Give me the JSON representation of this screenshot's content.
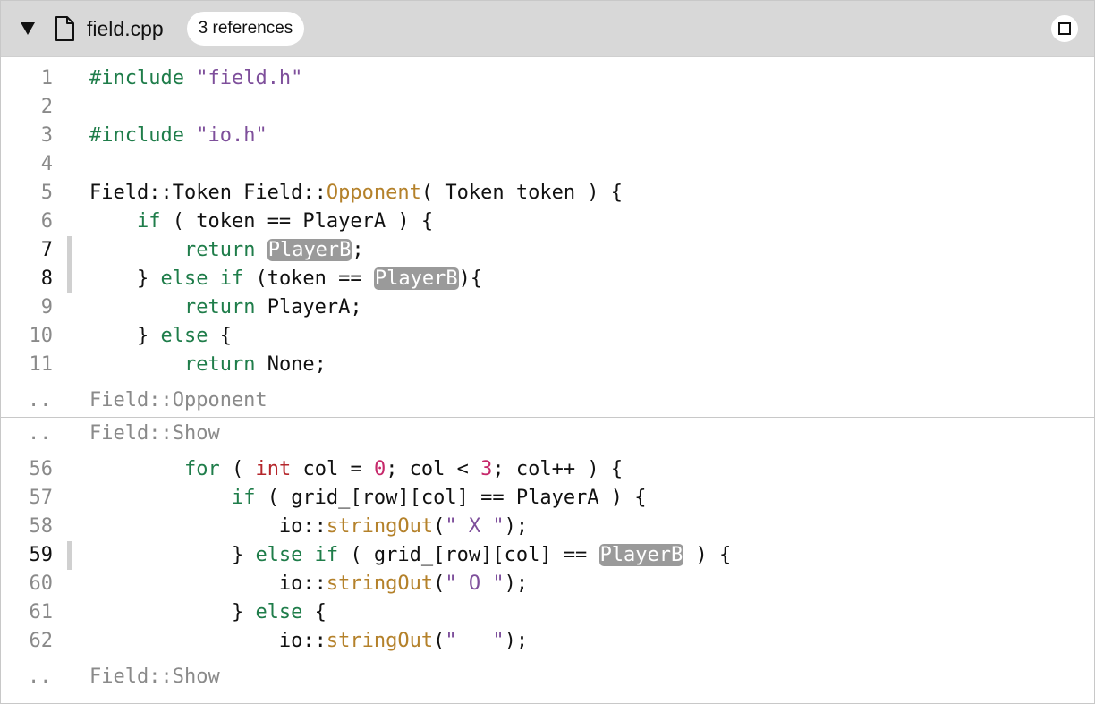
{
  "header": {
    "file_name": "field.cpp",
    "references_badge": "3 references"
  },
  "sections": [
    {
      "lines": [
        {
          "num": "1",
          "active": false,
          "marker": false,
          "tokens": [
            {
              "t": "kw",
              "v": "#include"
            },
            {
              "t": "",
              "v": " "
            },
            {
              "t": "str",
              "v": "\"field.h\""
            }
          ]
        },
        {
          "num": "2",
          "active": false,
          "marker": false,
          "tokens": []
        },
        {
          "num": "3",
          "active": false,
          "marker": false,
          "tokens": [
            {
              "t": "kw",
              "v": "#include"
            },
            {
              "t": "",
              "v": " "
            },
            {
              "t": "str",
              "v": "\"io.h\""
            }
          ]
        },
        {
          "num": "4",
          "active": false,
          "marker": false,
          "tokens": []
        },
        {
          "num": "5",
          "active": false,
          "marker": false,
          "tokens": [
            {
              "t": "",
              "v": "Field::Token Field::"
            },
            {
              "t": "fn",
              "v": "Opponent"
            },
            {
              "t": "",
              "v": "( Token token ) {"
            }
          ]
        },
        {
          "num": "6",
          "active": false,
          "marker": false,
          "tokens": [
            {
              "t": "",
              "v": "    "
            },
            {
              "t": "kw",
              "v": "if"
            },
            {
              "t": "",
              "v": " ( token == PlayerA ) {"
            }
          ]
        },
        {
          "num": "7",
          "active": true,
          "marker": true,
          "tokens": [
            {
              "t": "",
              "v": "        "
            },
            {
              "t": "kw",
              "v": "return"
            },
            {
              "t": "",
              "v": " "
            },
            {
              "t": "hl",
              "v": "PlayerB"
            },
            {
              "t": "",
              "v": ";"
            }
          ]
        },
        {
          "num": "8",
          "active": true,
          "marker": true,
          "tokens": [
            {
              "t": "",
              "v": "    } "
            },
            {
              "t": "kw",
              "v": "else if"
            },
            {
              "t": "",
              "v": " (token == "
            },
            {
              "t": "hl",
              "v": "PlayerB"
            },
            {
              "t": "",
              "v": "){"
            }
          ]
        },
        {
          "num": "9",
          "active": false,
          "marker": false,
          "tokens": [
            {
              "t": "",
              "v": "        "
            },
            {
              "t": "kw",
              "v": "return"
            },
            {
              "t": "",
              "v": " PlayerA;"
            }
          ]
        },
        {
          "num": "10",
          "active": false,
          "marker": false,
          "tokens": [
            {
              "t": "",
              "v": "    } "
            },
            {
              "t": "kw",
              "v": "else"
            },
            {
              "t": "",
              "v": " {"
            }
          ]
        },
        {
          "num": "11",
          "active": false,
          "marker": false,
          "tokens": [
            {
              "t": "",
              "v": "        "
            },
            {
              "t": "kw",
              "v": "return"
            },
            {
              "t": "",
              "v": " None;"
            }
          ]
        }
      ],
      "fold_after": {
        "dots": "..",
        "label": "Field::Opponent"
      }
    },
    {
      "fold_before": {
        "dots": "..",
        "label": "Field::Show"
      },
      "lines": [
        {
          "num": "56",
          "active": false,
          "marker": false,
          "tokens": [
            {
              "t": "",
              "v": "        "
            },
            {
              "t": "kw",
              "v": "for"
            },
            {
              "t": "",
              "v": " ( "
            },
            {
              "t": "ty",
              "v": "int"
            },
            {
              "t": "",
              "v": " col = "
            },
            {
              "t": "num",
              "v": "0"
            },
            {
              "t": "",
              "v": "; col < "
            },
            {
              "t": "num",
              "v": "3"
            },
            {
              "t": "",
              "v": "; col++ ) {"
            }
          ]
        },
        {
          "num": "57",
          "active": false,
          "marker": false,
          "tokens": [
            {
              "t": "",
              "v": "            "
            },
            {
              "t": "kw",
              "v": "if"
            },
            {
              "t": "",
              "v": " ( grid_[row][col] == PlayerA ) {"
            }
          ]
        },
        {
          "num": "58",
          "active": false,
          "marker": false,
          "tokens": [
            {
              "t": "",
              "v": "                io::"
            },
            {
              "t": "fn",
              "v": "stringOut"
            },
            {
              "t": "",
              "v": "("
            },
            {
              "t": "str",
              "v": "\" X \""
            },
            {
              "t": "",
              "v": ");"
            }
          ]
        },
        {
          "num": "59",
          "active": true,
          "marker": true,
          "tokens": [
            {
              "t": "",
              "v": "            } "
            },
            {
              "t": "kw",
              "v": "else if"
            },
            {
              "t": "",
              "v": " ( grid_[row][col] == "
            },
            {
              "t": "hl",
              "v": "PlayerB"
            },
            {
              "t": "",
              "v": " ) {"
            }
          ]
        },
        {
          "num": "60",
          "active": false,
          "marker": false,
          "tokens": [
            {
              "t": "",
              "v": "                io::"
            },
            {
              "t": "fn",
              "v": "stringOut"
            },
            {
              "t": "",
              "v": "("
            },
            {
              "t": "str",
              "v": "\" O \""
            },
            {
              "t": "",
              "v": ");"
            }
          ]
        },
        {
          "num": "61",
          "active": false,
          "marker": false,
          "tokens": [
            {
              "t": "",
              "v": "            } "
            },
            {
              "t": "kw",
              "v": "else"
            },
            {
              "t": "",
              "v": " {"
            }
          ]
        },
        {
          "num": "62",
          "active": false,
          "marker": false,
          "tokens": [
            {
              "t": "",
              "v": "                io::"
            },
            {
              "t": "fn",
              "v": "stringOut"
            },
            {
              "t": "",
              "v": "("
            },
            {
              "t": "str",
              "v": "\"   \""
            },
            {
              "t": "",
              "v": ");"
            }
          ]
        }
      ],
      "fold_after": {
        "dots": "..",
        "label": "Field::Show"
      }
    }
  ]
}
